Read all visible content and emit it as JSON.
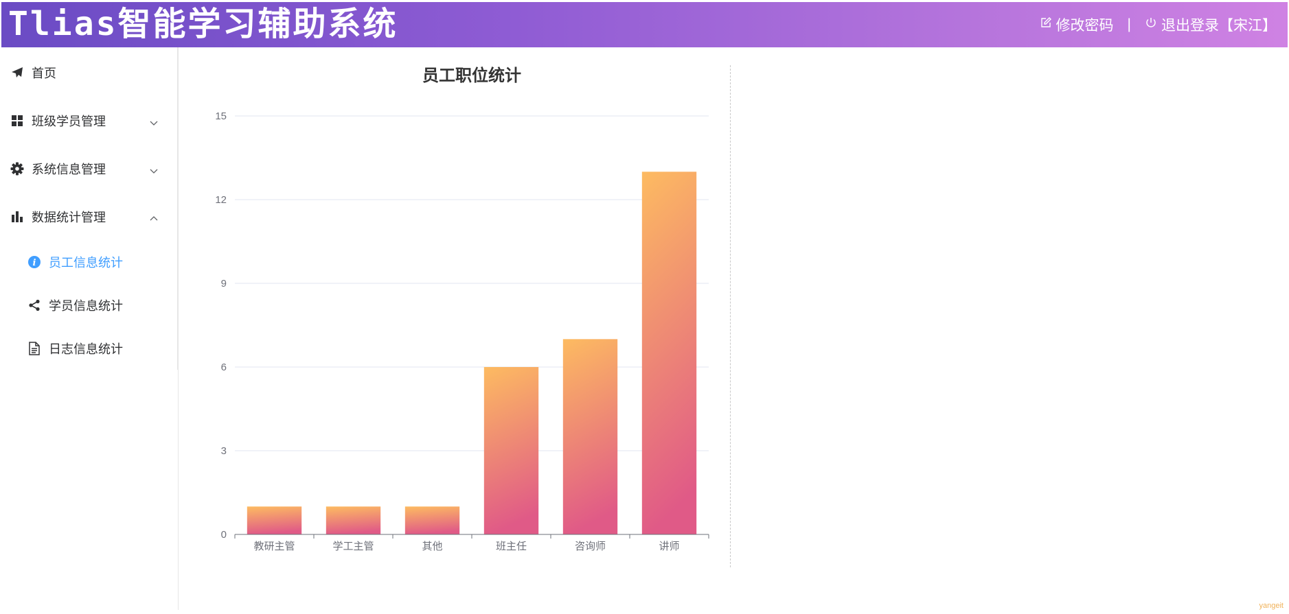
{
  "header": {
    "title": "Tlias智能学习辅助系统",
    "change_password": "修改密码",
    "separator": "|",
    "logout": "退出登录【宋江】"
  },
  "sidebar": {
    "items": [
      {
        "label": "首页",
        "icon": "paper-plane-icon"
      },
      {
        "label": "班级学员管理",
        "icon": "grid-icon",
        "expanded": false
      },
      {
        "label": "系统信息管理",
        "icon": "gear-icon",
        "expanded": false
      },
      {
        "label": "数据统计管理",
        "icon": "bar-chart-icon",
        "expanded": true
      }
    ],
    "sub_items": [
      {
        "label": "员工信息统计",
        "icon": "info-circle-icon",
        "active": true
      },
      {
        "label": "学员信息统计",
        "icon": "share-icon",
        "active": false
      },
      {
        "label": "日志信息统计",
        "icon": "document-icon",
        "active": false
      }
    ]
  },
  "colors": {
    "header_gradient_start": "#6a4bc4",
    "header_gradient_end": "#cf82e3",
    "active": "#409eff",
    "bar_top": "#fdbb61",
    "bar_bottom": "#e05a87"
  },
  "chart_data": {
    "type": "bar",
    "title": "员工职位统计",
    "categories": [
      "教研主管",
      "学工主管",
      "其他",
      "班主任",
      "咨询师",
      "讲师"
    ],
    "values": [
      1,
      1,
      1,
      6,
      7,
      13
    ],
    "ylim": [
      0,
      15
    ],
    "yticks": [
      "0",
      "3",
      "6",
      "9",
      "12",
      "15"
    ],
    "xlabel": "",
    "ylabel": "",
    "grid": true
  },
  "watermark": "yangeit"
}
